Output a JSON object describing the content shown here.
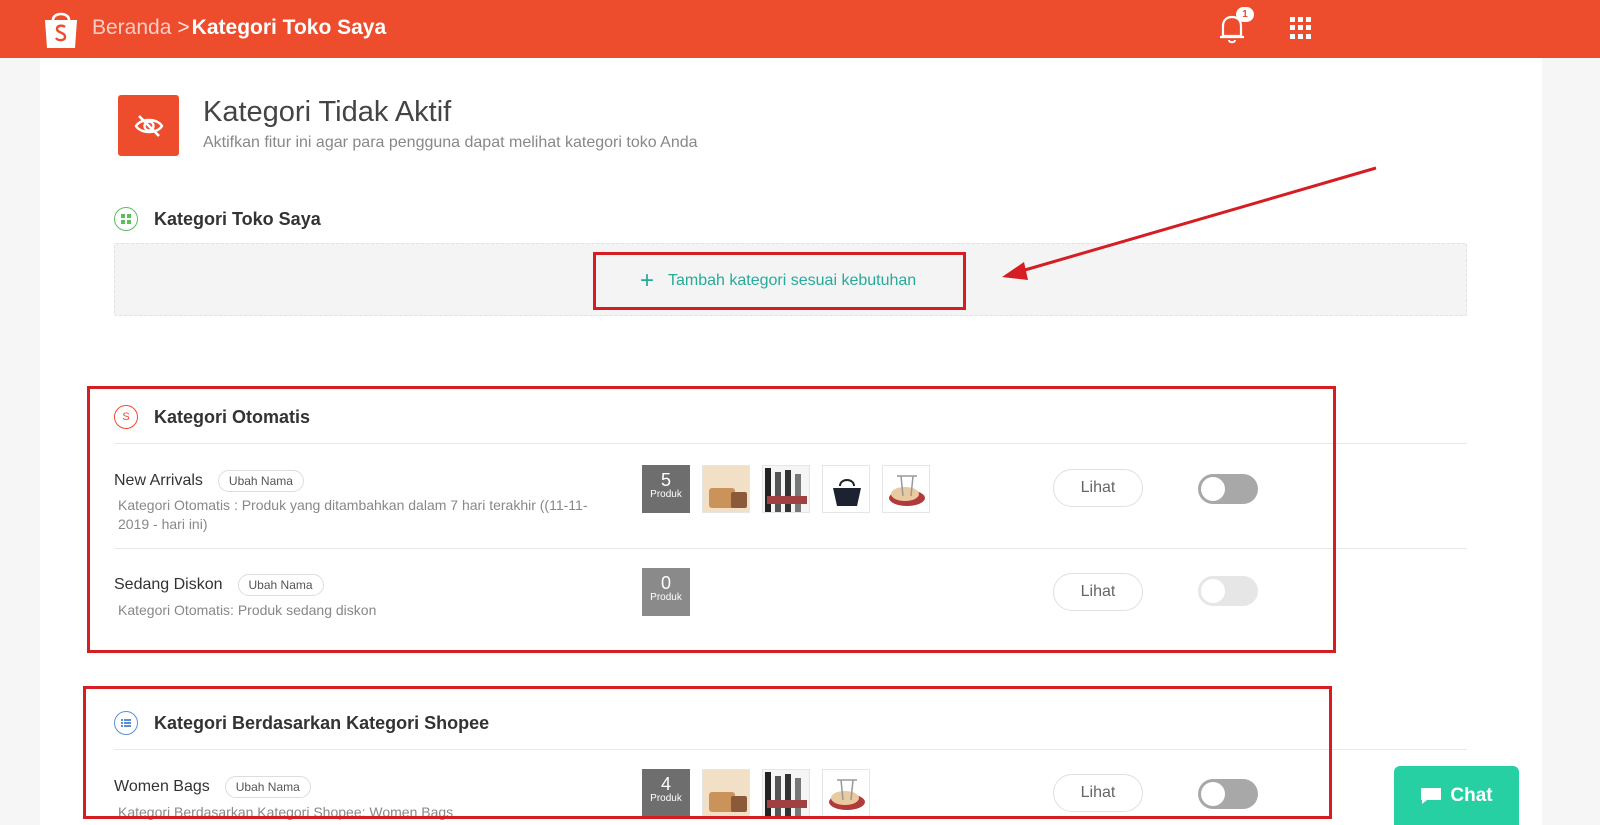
{
  "header": {
    "breadcrumb_home": "Beranda",
    "breadcrumb_sep": ">",
    "breadcrumb_current": "Kategori Toko Saya",
    "notification_count": "1",
    "brand_color": "#ee4d2d"
  },
  "hero": {
    "title": "Kategori Tidak Aktif",
    "subtitle": "Aktifkan fitur ini agar para pengguna dapat melihat kategori toko Anda",
    "icon": "eye-off-icon"
  },
  "my_categories": {
    "title": "Kategori Toko Saya",
    "add_label": "Tambah kategori sesuai kebutuhan",
    "accent_color": "#26aa99"
  },
  "auto_categories": {
    "title": "Kategori Otomatis",
    "rows": [
      {
        "name": "New Arrivals",
        "rename_label": "Ubah Nama",
        "desc_line1": "Kategori Otomatis : Produk yang ditambahkan dalam 7 hari terakhir ((11-11-",
        "desc_line2": "2019 - hari ini)",
        "count": "5",
        "count_label": "Produk",
        "view_label": "Lihat",
        "toggle_on": false
      },
      {
        "name": "Sedang Diskon",
        "rename_label": "Ubah Nama",
        "desc_line1": "Kategori Otomatis: Produk sedang diskon",
        "count": "0",
        "count_label": "Produk",
        "view_label": "Lihat",
        "toggle_on": false
      }
    ]
  },
  "shopee_categories": {
    "title": "Kategori Berdasarkan Kategori Shopee",
    "rows": [
      {
        "name": "Women Bags",
        "rename_label": "Ubah Nama",
        "desc_line1": "Kategori Berdasarkan Kategori Shopee: Women Bags",
        "count": "4",
        "count_label": "Produk",
        "view_label": "Lihat",
        "toggle_on": false
      }
    ]
  },
  "chat": {
    "label": "Chat",
    "color": "#26d0a3"
  },
  "annotation_color": "#d51d23"
}
